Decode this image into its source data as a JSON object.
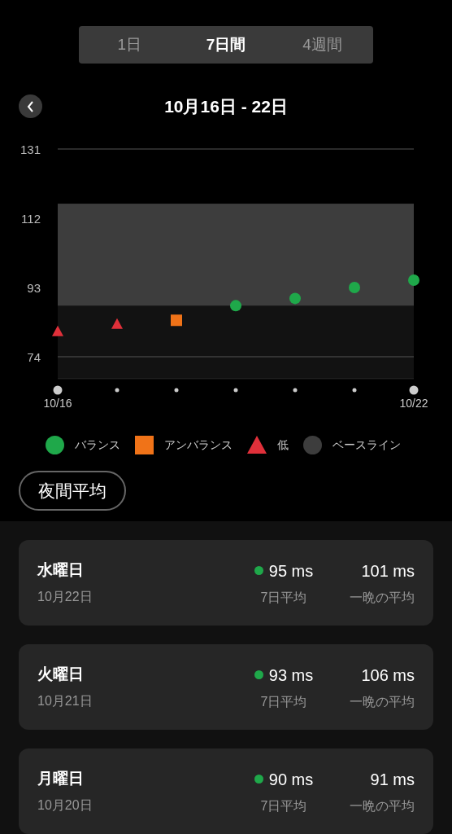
{
  "tabs": [
    {
      "label": "1日",
      "selected": false
    },
    {
      "label": "7日間",
      "selected": true
    },
    {
      "label": "4週間",
      "selected": false
    }
  ],
  "header": {
    "title": "10月16日 - 22日"
  },
  "chart": {
    "chart_data": {
      "type": "scatter",
      "categories": [
        "10/16",
        null,
        null,
        null,
        null,
        null,
        "10/22"
      ],
      "yticks": [
        74,
        93,
        112,
        131
      ],
      "ylim": [
        68,
        131
      ],
      "series": [
        {
          "name": "バランス",
          "color": "#1fa84a",
          "values": [
            null,
            null,
            null,
            88,
            90,
            93,
            95
          ]
        },
        {
          "name": "アンバランス",
          "color": "#f07318",
          "values": [
            null,
            null,
            84,
            null,
            null,
            null,
            null
          ]
        },
        {
          "name": "低",
          "color": "#e0303a",
          "values": [
            81,
            83,
            null,
            null,
            null,
            null,
            null
          ]
        }
      ],
      "bands": [
        {
          "axis": "y",
          "from": 68,
          "to": 88,
          "color": "#121212"
        },
        {
          "axis": "y",
          "from": 88,
          "to": 116,
          "color": "#3d3d3d"
        }
      ]
    },
    "baseline_label": "ベースライン",
    "legend_markers": [
      {
        "kind": "circle"
      },
      {
        "kind": "square"
      },
      {
        "kind": "triangle"
      },
      {
        "kind": "circle"
      }
    ]
  },
  "filter_button": "夜間平均",
  "days": [
    {
      "weekday": "水曜日",
      "date": "10月22日",
      "avg_value": "95 ms",
      "avg_label": "7日平均",
      "color": "#1fa84a",
      "night_value": "101 ms",
      "night_label": "一晩の平均"
    },
    {
      "weekday": "火曜日",
      "date": "10月21日",
      "avg_value": "93 ms",
      "avg_label": "7日平均",
      "color": "#1fa84a",
      "night_value": "106 ms",
      "night_label": "一晩の平均"
    },
    {
      "weekday": "月曜日",
      "date": "10月20日",
      "avg_value": "90 ms",
      "avg_label": "7日平均",
      "color": "#1fa84a",
      "night_value": "91 ms",
      "night_label": "一晩の平均"
    }
  ]
}
